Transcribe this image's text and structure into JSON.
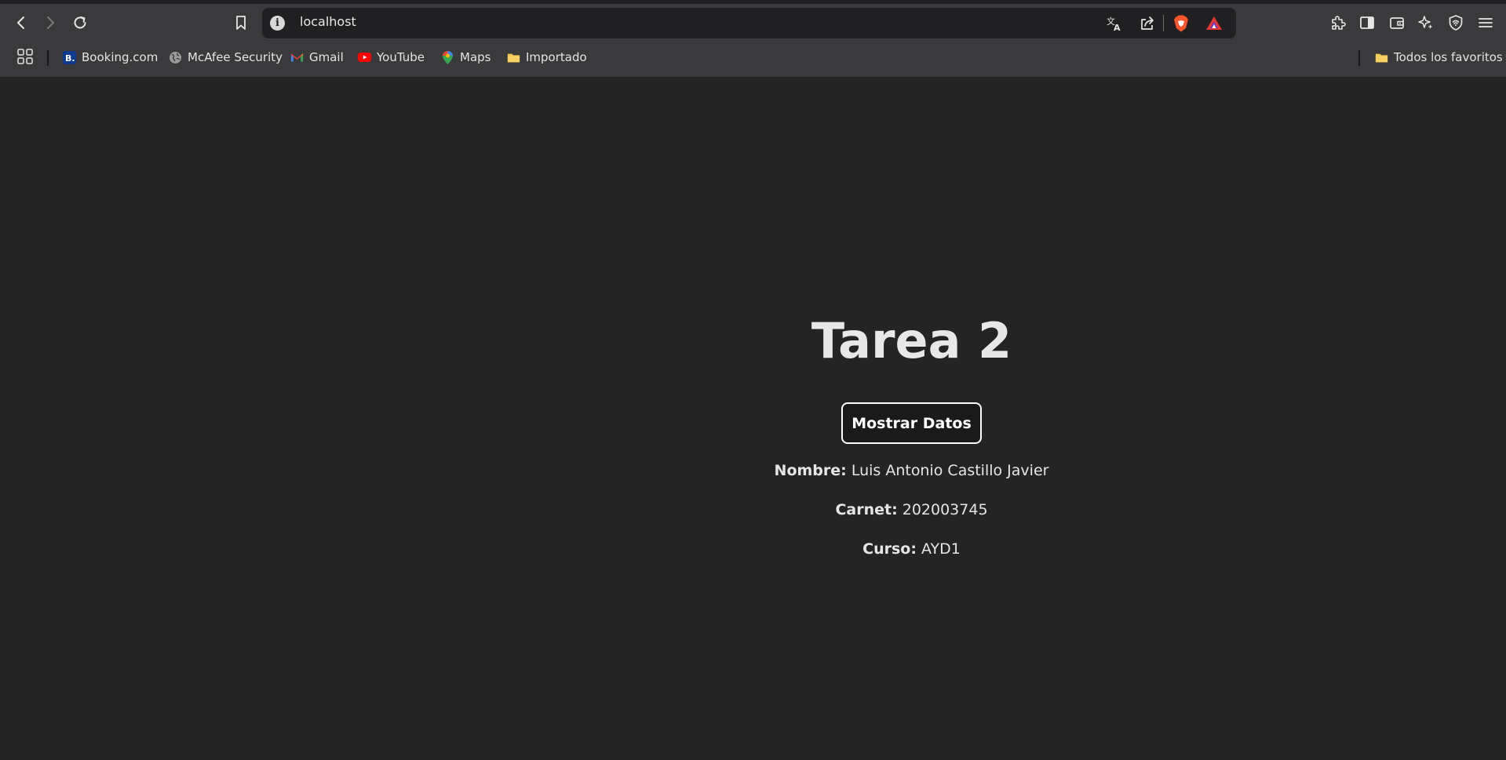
{
  "browser": {
    "url": "localhost",
    "bookmarks": [
      {
        "label": "Booking.com",
        "icon": "booking-icon"
      },
      {
        "label": "McAfee Security",
        "icon": "globe-icon"
      },
      {
        "label": "Gmail",
        "icon": "gmail-icon"
      },
      {
        "label": "YouTube",
        "icon": "youtube-icon"
      },
      {
        "label": "Maps",
        "icon": "maps-pin-icon"
      },
      {
        "label": "Importado",
        "icon": "folder-icon"
      }
    ],
    "all_bookmarks_label": "Todos los favoritos",
    "colors": {
      "chrome_bg": "#3a3a3d",
      "urlbar_bg": "#202022",
      "page_bg": "#242424",
      "brave_orange": "#fb542b",
      "youtube_red": "#ff0000",
      "folder_yellow": "#f5c84c"
    }
  },
  "page": {
    "title": "Tarea 2",
    "button_label": "Mostrar Datos",
    "fields": [
      {
        "label": "Nombre:",
        "value": "Luis Antonio Castillo Javier"
      },
      {
        "label": "Carnet:",
        "value": "202003745"
      },
      {
        "label": "Curso:",
        "value": "AYD1"
      }
    ]
  }
}
